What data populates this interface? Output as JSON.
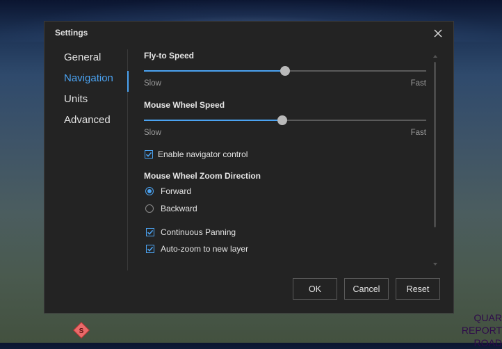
{
  "dialog": {
    "title": "Settings",
    "close_icon": "close-icon"
  },
  "sidebar": {
    "items": [
      {
        "label": "General",
        "active": false
      },
      {
        "label": "Navigation",
        "active": true
      },
      {
        "label": "Units",
        "active": false
      },
      {
        "label": "Advanced",
        "active": false
      }
    ]
  },
  "navigation": {
    "fly_to_speed": {
      "label": "Fly-to Speed",
      "min_label": "Slow",
      "max_label": "Fast",
      "value": 0.5
    },
    "mouse_wheel_speed": {
      "label": "Mouse Wheel Speed",
      "min_label": "Slow",
      "max_label": "Fast",
      "value": 0.49
    },
    "enable_navigator": {
      "label": "Enable navigator control",
      "checked": true
    },
    "zoom_direction": {
      "label": "Mouse Wheel Zoom Direction",
      "options": [
        {
          "label": "Forward",
          "selected": true
        },
        {
          "label": "Backward",
          "selected": false
        }
      ]
    },
    "continuous_panning": {
      "label": "Continuous Panning",
      "checked": true
    },
    "auto_zoom": {
      "label": "Auto-zoom to new layer",
      "checked": true
    }
  },
  "buttons": {
    "ok": "OK",
    "cancel": "Cancel",
    "reset": "Reset"
  },
  "background": {
    "map_text_lines": [
      "QUAR",
      "REPORT",
      "ROAD"
    ],
    "colors": {
      "accent": "#4ba3f2",
      "dialog_bg": "#232323"
    }
  }
}
